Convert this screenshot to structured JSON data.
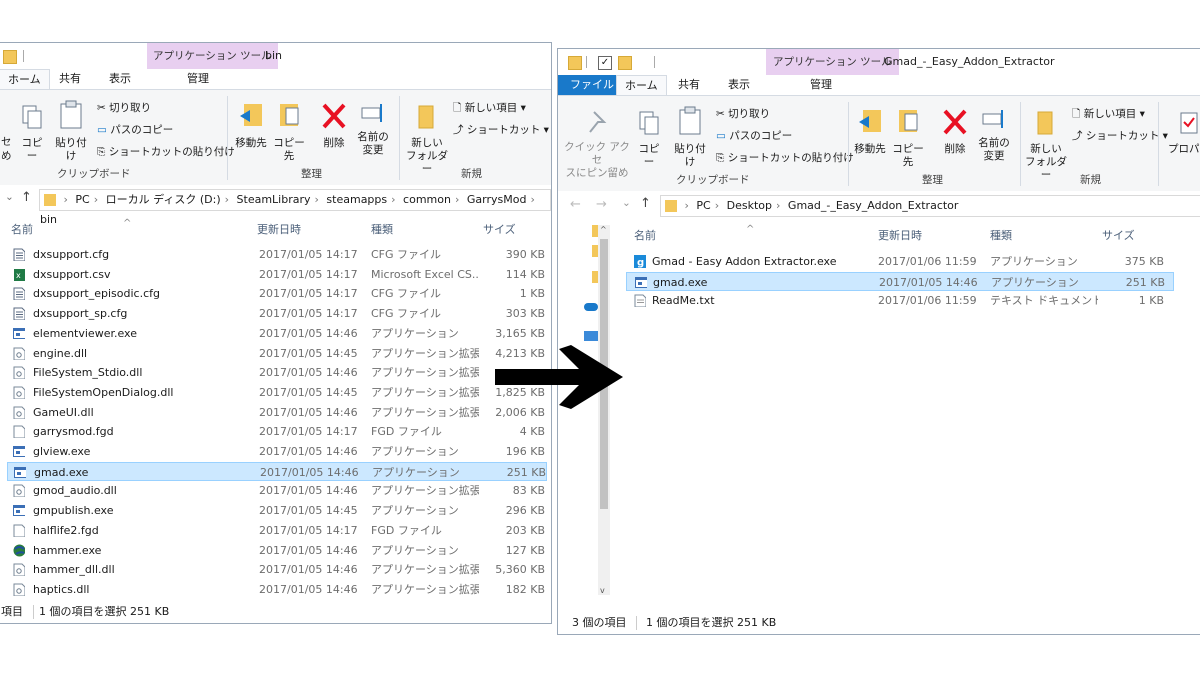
{
  "left": {
    "context_tab": "アプリケーション ツール",
    "window_title": "bin",
    "tabs": [
      "ホーム",
      "共有",
      "表示",
      "管理"
    ],
    "ribbon": {
      "paste_partial": "セ",
      "paste_partial2": "め",
      "copy": "コピー",
      "paste": "貼り付け",
      "cut": "切り取り",
      "copy_path": "パスのコピー",
      "paste_shortcut": "ショートカットの貼り付け",
      "move_to": "移動先",
      "copy_to": "コピー先",
      "delete": "削除",
      "rename1": "名前の",
      "rename2": "変更",
      "new_folder1": "新しい",
      "new_folder2": "フォルダー",
      "new_item": "新しい項目 ▾",
      "shortcut": "ショートカット ▾",
      "group_clipboard": "クリップボード",
      "group_organize": "整理",
      "group_new": "新規"
    },
    "breadcrumb": [
      "PC",
      "ローカル ディスク (D:)",
      "SteamLibrary",
      "steamapps",
      "common",
      "GarrysMod",
      "bin"
    ],
    "columns": {
      "name": "名前",
      "date": "更新日時",
      "type": "種類",
      "size": "サイズ"
    },
    "files": [
      {
        "name": "dxsupport.cfg",
        "date": "2017/01/05 14:17",
        "type": "CFG ファイル",
        "size": "390 KB",
        "icon": "cfg-file-icon"
      },
      {
        "name": "dxsupport.csv",
        "date": "2017/01/05 14:17",
        "type": "Microsoft Excel CS...",
        "size": "114 KB",
        "icon": "excel-file-icon"
      },
      {
        "name": "dxsupport_episodic.cfg",
        "date": "2017/01/05 14:17",
        "type": "CFG ファイル",
        "size": "1 KB",
        "icon": "cfg-file-icon"
      },
      {
        "name": "dxsupport_sp.cfg",
        "date": "2017/01/05 14:17",
        "type": "CFG ファイル",
        "size": "303 KB",
        "icon": "cfg-file-icon"
      },
      {
        "name": "elementviewer.exe",
        "date": "2017/01/05 14:46",
        "type": "アプリケーション",
        "size": "3,165 KB",
        "icon": "exe-file-icon"
      },
      {
        "name": "engine.dll",
        "date": "2017/01/05 14:45",
        "type": "アプリケーション拡張",
        "size": "4,213 KB",
        "icon": "dll-file-icon"
      },
      {
        "name": "FileSystem_Stdio.dll",
        "date": "2017/01/05 14:46",
        "type": "アプリケーション拡張",
        "size": "",
        "icon": "dll-file-icon"
      },
      {
        "name": "FileSystemOpenDialog.dll",
        "date": "2017/01/05 14:45",
        "type": "アプリケーション拡張",
        "size": "1,825 KB",
        "icon": "dll-file-icon"
      },
      {
        "name": "GameUI.dll",
        "date": "2017/01/05 14:46",
        "type": "アプリケーション拡張",
        "size": "2,006 KB",
        "icon": "dll-file-icon"
      },
      {
        "name": "garrysmod.fgd",
        "date": "2017/01/05 14:17",
        "type": "FGD ファイル",
        "size": "4 KB",
        "icon": "fgd-file-icon"
      },
      {
        "name": "glview.exe",
        "date": "2017/01/05 14:46",
        "type": "アプリケーション",
        "size": "196 KB",
        "icon": "exe-file-icon"
      },
      {
        "name": "gmad.exe",
        "date": "2017/01/05 14:46",
        "type": "アプリケーション",
        "size": "251 KB",
        "icon": "exe-file-icon",
        "selected": true
      },
      {
        "name": "gmod_audio.dll",
        "date": "2017/01/05 14:46",
        "type": "アプリケーション拡張",
        "size": "83 KB",
        "icon": "dll-file-icon"
      },
      {
        "name": "gmpublish.exe",
        "date": "2017/01/05 14:45",
        "type": "アプリケーション",
        "size": "296 KB",
        "icon": "exe-file-icon"
      },
      {
        "name": "halflife2.fgd",
        "date": "2017/01/05 14:17",
        "type": "FGD ファイル",
        "size": "203 KB",
        "icon": "fgd-file-icon"
      },
      {
        "name": "hammer.exe",
        "date": "2017/01/05 14:46",
        "type": "アプリケーション",
        "size": "127 KB",
        "icon": "globe-exe-icon"
      },
      {
        "name": "hammer_dll.dll",
        "date": "2017/01/05 14:46",
        "type": "アプリケーション拡張",
        "size": "5,360 KB",
        "icon": "dll-file-icon"
      },
      {
        "name": "haptics.dll",
        "date": "2017/01/05 14:46",
        "type": "アプリケーション拡張",
        "size": "182 KB",
        "icon": "dll-file-icon"
      }
    ],
    "status_items": "項目",
    "status_selected": "1 個の項目を選択  251 KB"
  },
  "right": {
    "context_tab": "アプリケーション ツール",
    "window_title": "Gmad_-_Easy_Addon_Extractor",
    "tabs": [
      "ファイル",
      "ホーム",
      "共有",
      "表示",
      "管理"
    ],
    "ribbon": {
      "quick_access1": "クイック アクセ",
      "quick_access2": "スにピン留め",
      "copy": "コピー",
      "paste": "貼り付け",
      "cut": "切り取り",
      "copy_path": "パスのコピー",
      "paste_shortcut": "ショートカットの貼り付け",
      "move_to": "移動先",
      "copy_to": "コピー先",
      "delete": "削除",
      "rename1": "名前の",
      "rename2": "変更",
      "new_folder1": "新しい",
      "new_folder2": "フォルダー",
      "new_item": "新しい項目 ▾",
      "shortcut": "ショートカット ▾",
      "properties": "プロパテ",
      "group_clipboard": "クリップボード",
      "group_organize": "整理",
      "group_new": "新規"
    },
    "breadcrumb": [
      "PC",
      "Desktop",
      "Gmad_-_Easy_Addon_Extractor"
    ],
    "columns": {
      "name": "名前",
      "date": "更新日時",
      "type": "種類",
      "size": "サイズ"
    },
    "files": [
      {
        "name": "Gmad - Easy Addon Extractor.exe",
        "date": "2017/01/06 11:59",
        "type": "アプリケーション",
        "size": "375 KB",
        "icon": "gmad-app-icon"
      },
      {
        "name": "gmad.exe",
        "date": "2017/01/05 14:46",
        "type": "アプリケーション",
        "size": "251 KB",
        "icon": "exe-file-icon",
        "selected": true
      },
      {
        "name": "ReadMe.txt",
        "date": "2017/01/06 11:59",
        "type": "テキスト ドキュメント",
        "size": "1 KB",
        "icon": "txt-file-icon"
      }
    ],
    "status_items": "3 個の項目",
    "status_selected": "1 個の項目を選択  251 KB"
  },
  "colors": {
    "selection": "#cce8ff",
    "context_tab": "#e8cff0",
    "file_tab": "#1979ca",
    "arrow": "#000000"
  }
}
